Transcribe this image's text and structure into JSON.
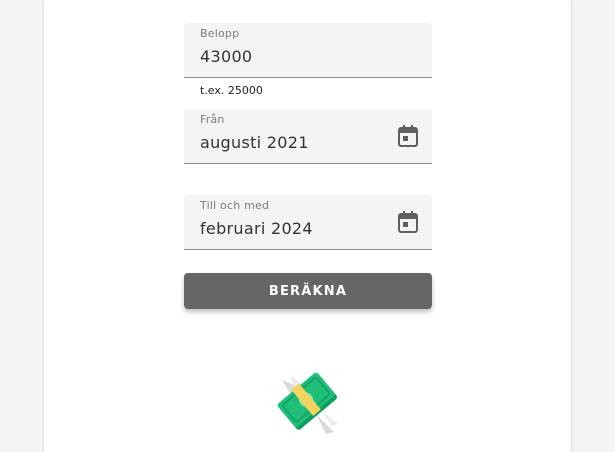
{
  "form": {
    "amount": {
      "label": "Belopp",
      "value": "43000",
      "helper": "t.ex. 25000"
    },
    "from": {
      "label": "Från",
      "value": "augusti 2021"
    },
    "to": {
      "label": "Till och med",
      "value": "februari 2024"
    },
    "submit_label": "BERÄKNA"
  },
  "icons": {
    "calendar": "calendar-icon",
    "money": "flying-money-icon"
  },
  "colors": {
    "button": "#666666",
    "field_background": "#f4f4f4",
    "money_green": "#1fbf7a"
  }
}
